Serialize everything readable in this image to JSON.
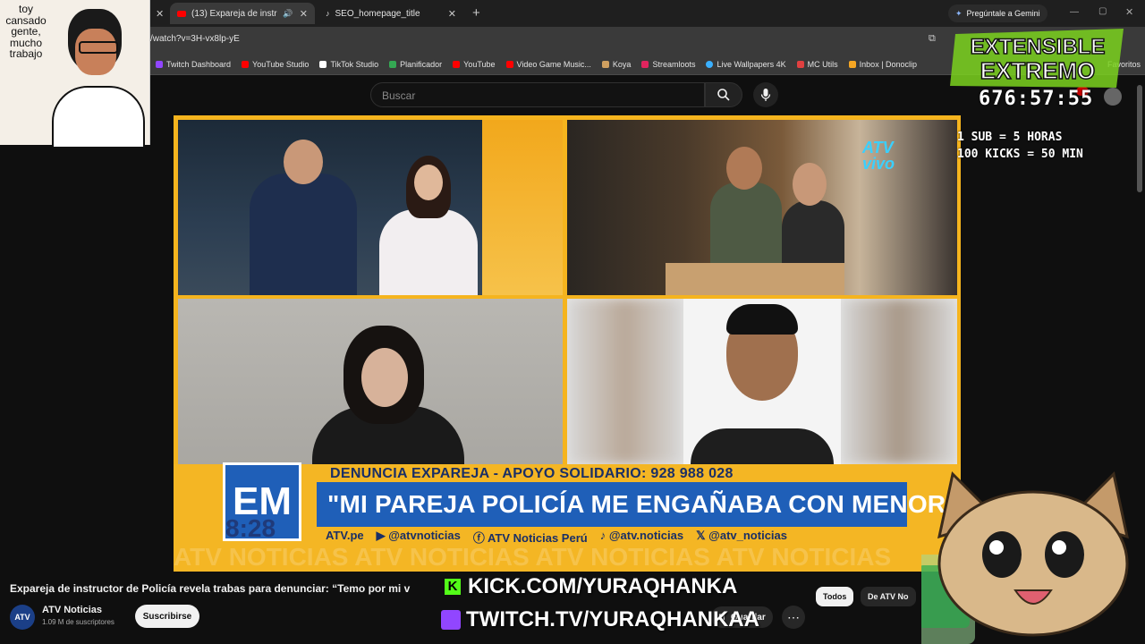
{
  "browser": {
    "tabs": [
      {
        "title": "(13) Expareja de instructor d",
        "active": true
      },
      {
        "title": "SEO_homepage_title",
        "active": false
      }
    ],
    "new_tab": "+",
    "gemini_button": "Pregúntale a Gemini",
    "url": "/watch?v=3H-vx8lp-yE",
    "bookmarks": [
      {
        "label": "Twitch Dashboard",
        "color": "#9146ff"
      },
      {
        "label": "YouTube Studio",
        "color": "#ff0000"
      },
      {
        "label": "TikTok Studio",
        "color": "#ffffff"
      },
      {
        "label": "Planificador",
        "color": "#34a853"
      },
      {
        "label": "YouTube",
        "color": "#ff0000"
      },
      {
        "label": "Video Game Music...",
        "color": "#ff0000"
      },
      {
        "label": "Koya",
        "color": "#d0a060"
      },
      {
        "label": "Streamloots",
        "color": "#e0245e"
      },
      {
        "label": "Live Wallpapers 4K",
        "color": "#3ab0ff"
      },
      {
        "label": "MC Utils",
        "color": "#e04040"
      },
      {
        "label": "Inbox | Donoclip",
        "color": "#f5a623"
      }
    ],
    "bookmarks_more": "Favoritos"
  },
  "youtube": {
    "search_placeholder": "Buscar",
    "video_title": "Expareja de instructor de Policía revela trabas para denunciar: “Temo por mi v",
    "channel": {
      "name": "ATV Noticias",
      "subs": "1.09 M de suscriptores",
      "avatar": "ATV"
    },
    "subscribe_label": "Suscribirse",
    "save_label": "Guardar",
    "more_label": "⋯",
    "chips": [
      "Todos",
      "De ATV No"
    ]
  },
  "broadcast": {
    "em_logo": "EM",
    "time": "8:28",
    "ticker": "DENUNCIA EXPAREJA - APOYO SOLIDARIO: 928 988 028",
    "headline": "\"MI PAREJA POLICÍA ME ENGAÑABA CON MENORES\"",
    "socials": [
      "ATV.pe",
      "@atvnoticias",
      "ATV Noticias Perú",
      "@atv.noticias",
      "@atv_noticias"
    ],
    "watermark": "ATV NOTICIAS ATV NOTICIAS ATV NOTICIAS ATV NOTICIAS",
    "atv_vivo": "ATV vivo"
  },
  "overlay": {
    "webcam_text": "toy cansado gente, mucho trabajo",
    "logo_line1": "EXTENSIBLE",
    "logo_line2": "EXTREMO",
    "timer": "676:57:55",
    "rules": "1 SUB = 5 HORAS\n100 KICKS = 50 MIN",
    "kick_url": "KICK.COM/YURAQHANKA",
    "twitch_url": "TWITCH.TV/YURAQHANKAA"
  },
  "colors": {
    "yt_bg": "#0f0f0f",
    "atv_blue": "#1f5fb8",
    "atv_yellow": "#f4b624",
    "kick_green": "#53fc18",
    "twitch_purple": "#9146ff"
  }
}
